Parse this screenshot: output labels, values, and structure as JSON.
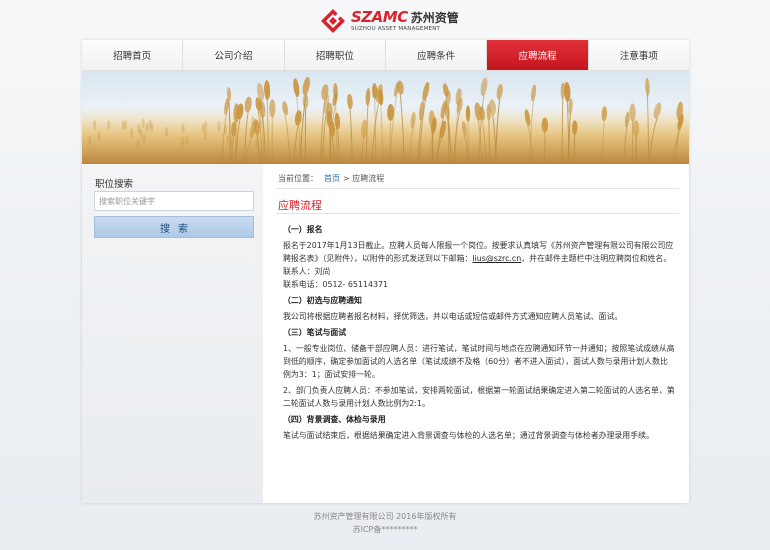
{
  "logo": {
    "brand_en": "SZAMC",
    "brand_cn": "苏州资管",
    "brand_sub": "SUZHOU ASSET MANAGEMENT",
    "icon": "szamc-logo-mark"
  },
  "colors": {
    "accent": "#d9232c",
    "nav_active": "#c4161f",
    "search_button": "#aec9e6",
    "link": "#2b6cb0"
  },
  "nav": {
    "items": [
      {
        "label": "招聘首页"
      },
      {
        "label": "公司介绍"
      },
      {
        "label": "招聘职位"
      },
      {
        "label": "应聘条件"
      },
      {
        "label": "应聘流程",
        "active": true
      },
      {
        "label": "注意事项"
      }
    ]
  },
  "sidebar": {
    "title": "职位搜索",
    "search_placeholder": "搜索职位关键字",
    "search_button": "搜索"
  },
  "breadcrumb": {
    "prefix": "当前位置：",
    "home": "首页",
    "separator": ">",
    "current": "应聘流程"
  },
  "content": {
    "heading": "应聘流程",
    "sections": {
      "s1_title": "（一）报名",
      "s1_p1": "报名于2017年1月13日截止。应聘人员每人限报一个岗位。按要求认真填写《苏州资产管理有限公司有限公司应聘报名表》（见附件），以附件的形式发送到以下邮箱：",
      "s1_email": "lius@szrc.cn",
      "s1_p1_tail": "，并在邮件主题栏中注明应聘岗位和姓名。",
      "s1_contact": "联系人：刘尚",
      "s1_phone": "联系电话：0512- 65114371",
      "s2_title": "（二）初选与应聘通知",
      "s2_p1": "我公司将根据应聘者报名材料，择优筛选，并以电话或短信或邮件方式通知应聘人员笔试、面试。",
      "s3_title": "（三）笔试与面试",
      "s3_p1": "1、一般专业岗位、储备干部应聘人员：进行笔试，笔试时间与地点在应聘通知环节一并通知；按照笔试成绩从高到低的顺序，确定参加面试的人选名单（笔试成绩不及格（60分）者不进入面试），面试人数与录用计划人数比例为3：1；面试安排一轮。",
      "s3_p2": "2、部门负责人应聘人员：不参加笔试，安排两轮面试，根据第一轮面试结果确定进入第二轮面试的人选名单，第二轮面试人数与录用计划人数比例为2:1。",
      "s4_title": "（四）背景调查、体检与录用",
      "s4_p1": "笔试与面试结束后，根据结果确定进入背景调查与体检的人选名单；通过背景调查与体检者办理录用手续。"
    }
  },
  "footer": {
    "copyright": "苏州资产管理有限公司 2016年版权所有",
    "icp": "苏ICP备*********"
  }
}
